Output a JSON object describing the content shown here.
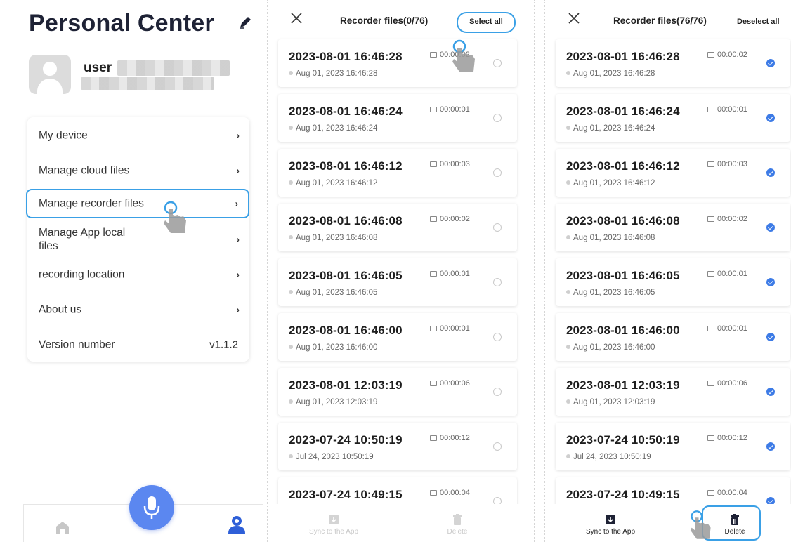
{
  "personal": {
    "title": "Personal Center",
    "user_name": "user",
    "menu": [
      {
        "label": "My device"
      },
      {
        "label": "Manage cloud files"
      },
      {
        "label": "Manage recorder files"
      },
      {
        "label": "Manage App local files"
      },
      {
        "label": "recording location"
      },
      {
        "label": "About us"
      }
    ],
    "version_label": "Version number",
    "version_value": "v1.1.2"
  },
  "recorder_select": {
    "title": "Recorder files(0/76)",
    "action": "Select all",
    "footer": {
      "sync": "Sync to the App",
      "delete": "Delete"
    }
  },
  "recorder_selected": {
    "title": "Recorder files(76/76)",
    "action": "Deselect all",
    "footer": {
      "sync": "Sync to the App",
      "delete": "Delete"
    }
  },
  "files": [
    {
      "name": "2023-08-01 16:46:28",
      "duration": "00:00:02",
      "date": "Aug 01, 2023 16:46:28"
    },
    {
      "name": "2023-08-01 16:46:24",
      "duration": "00:00:01",
      "date": "Aug 01, 2023 16:46:24"
    },
    {
      "name": "2023-08-01 16:46:12",
      "duration": "00:00:03",
      "date": "Aug 01, 2023 16:46:12"
    },
    {
      "name": "2023-08-01 16:46:08",
      "duration": "00:00:02",
      "date": "Aug 01, 2023 16:46:08"
    },
    {
      "name": "2023-08-01 16:46:05",
      "duration": "00:00:01",
      "date": "Aug 01, 2023 16:46:05"
    },
    {
      "name": "2023-08-01 16:46:00",
      "duration": "00:00:01",
      "date": "Aug 01, 2023 16:46:00"
    },
    {
      "name": "2023-08-01 12:03:19",
      "duration": "00:00:06",
      "date": "Aug 01, 2023 12:03:19"
    },
    {
      "name": "2023-07-24 10:50:19",
      "duration": "00:00:12",
      "date": "Jul 24, 2023 10:50:19"
    },
    {
      "name": "2023-07-24 10:49:15",
      "duration": "00:00:04",
      "date": "Jul 24, 2023 10:49:15"
    }
  ],
  "colors": {
    "accent": "#3aa0e6",
    "mic": "#5b87f0",
    "check": "#3d7be6",
    "title": "#1e2235"
  },
  "icons": [
    "edit-icon",
    "home-icon",
    "microphone-icon",
    "person-icon",
    "close-icon",
    "camera-icon",
    "sync-icon",
    "trash-icon",
    "hand-pointer-icon"
  ]
}
